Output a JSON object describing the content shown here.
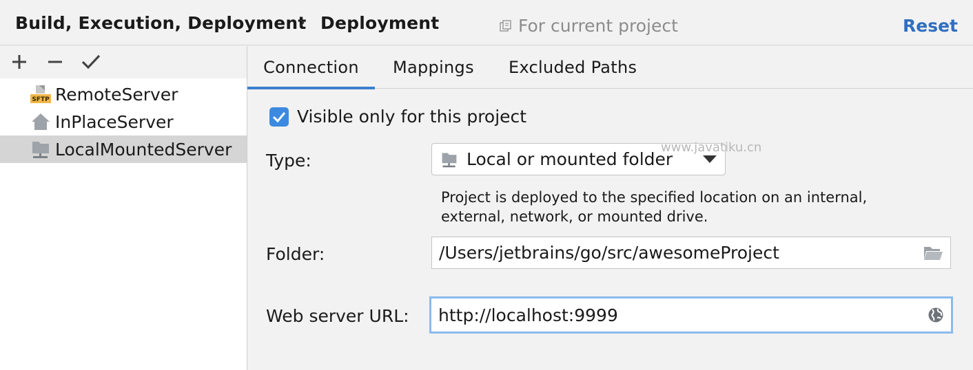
{
  "header": {
    "breadcrumb_parent": "Build, Execution, Deployment",
    "breadcrumb_sep": "›",
    "breadcrumb_current": "Deployment",
    "scope_label": "For current project",
    "reset_label": "Reset"
  },
  "toolbar": {
    "add_icon": "plus-icon",
    "remove_icon": "minus-icon",
    "default_icon": "checkmark-icon"
  },
  "servers": [
    {
      "label": "RemoteServer",
      "icon": "sftp-icon"
    },
    {
      "label": "InPlaceServer",
      "icon": "home-icon"
    },
    {
      "label": "LocalMountedServer",
      "icon": "mounted-folder-icon",
      "selected": true
    }
  ],
  "tabs": [
    {
      "label": "Connection",
      "active": true
    },
    {
      "label": "Mappings"
    },
    {
      "label": "Excluded Paths"
    }
  ],
  "connection": {
    "visible_only_label": "Visible only for this project",
    "visible_only_checked": true,
    "type_label": "Type:",
    "type_value": "Local or mounted folder",
    "type_description_line1": "Project is deployed to the specified location on an internal,",
    "type_description_line2": "external, network, or mounted drive.",
    "folder_label": "Folder:",
    "folder_value": "/Users/jetbrains/go/src/awesomeProject",
    "web_url_label": "Web server URL:",
    "web_url_value": "http://localhost:9999"
  },
  "watermark": "www.javatiku.cn",
  "colors": {
    "accent": "#3d7fcf",
    "link": "#2f6fbf",
    "checkbox": "#3b8ae0",
    "selection": "#d5d5d5"
  }
}
